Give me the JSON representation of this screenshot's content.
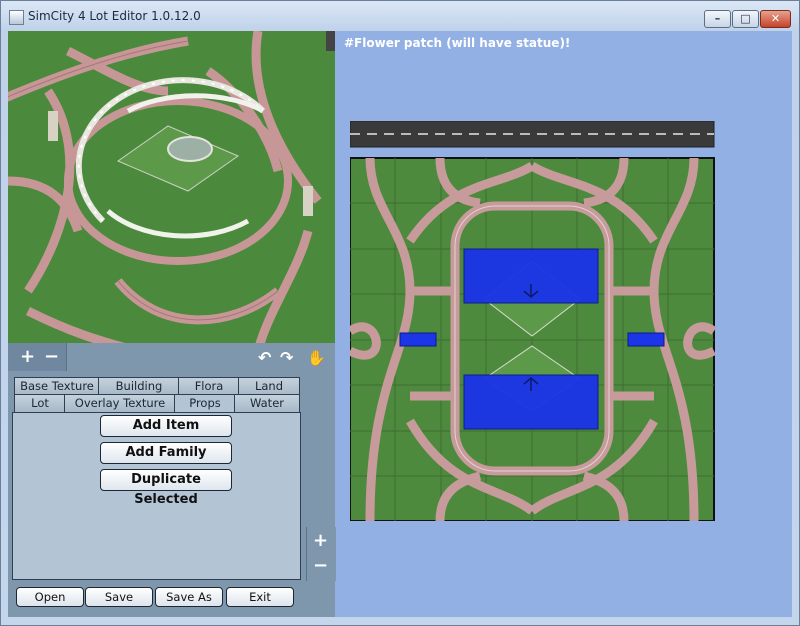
{
  "window": {
    "title": "SimCity 4 Lot Editor 1.0.12.0",
    "controls": {
      "minimize": "–",
      "maximize": "□",
      "close": "✕"
    }
  },
  "lot": {
    "name": "#Flower patch (will have statue)!"
  },
  "preview_tools": {
    "zoom_in": "+",
    "zoom_out": "−",
    "rotate_left": "↶",
    "rotate_right": "↷",
    "hand": "✋"
  },
  "tabs": {
    "row_back": [
      "Base Texture",
      "Building",
      "Flora",
      "Land"
    ],
    "row_front": [
      "Lot",
      "Overlay Texture",
      "Props",
      "Water"
    ],
    "active": "Props"
  },
  "props_actions": {
    "add_item": "Add Item",
    "add_family": "Add Family",
    "duplicate": "Duplicate Selected"
  },
  "side_zoom": {
    "in": "+",
    "out": "−"
  },
  "footer": {
    "open": "Open",
    "save": "Save",
    "save_as": "Save As",
    "exit": "Exit"
  },
  "colors": {
    "grass": "#4d8a3e",
    "path": "#c99a9a",
    "selection": "#1c35e6",
    "client": "#93b0e4",
    "panel": "#7f97ad"
  },
  "icons": [
    "app-icon",
    "rotate-left-icon",
    "rotate-right-icon",
    "hand-icon"
  ]
}
